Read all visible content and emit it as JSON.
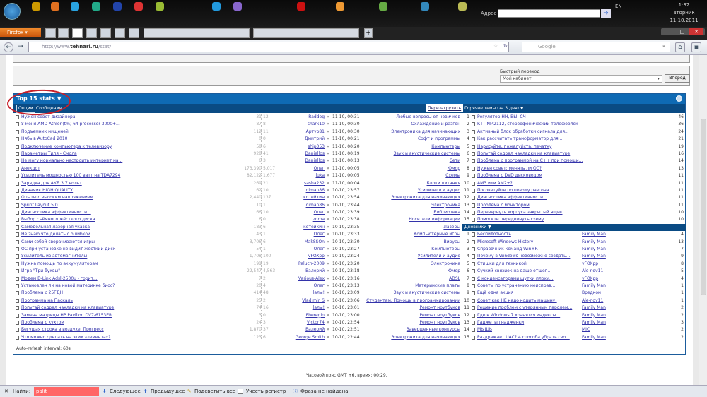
{
  "taskbar": {
    "address_label": "Адрес",
    "lang": "EN",
    "time": "1:32",
    "weekday": "вторник",
    "date": "11.10.2011"
  },
  "browser": {
    "menu_label": "Firefox",
    "url_host": "http://www.",
    "url_domain": "tehnari.ru",
    "url_path": "/stat/",
    "search_placeholder": "Google",
    "new_tab": "+"
  },
  "quick_jump": {
    "label": "Быстрый переход",
    "value": "Мой кабинет",
    "button": "Вперед"
  },
  "stats": {
    "title": "Top 15 stats ▼",
    "options": "Опции",
    "messages": "Сообщения",
    "reload": "Перезагрузить",
    "hot_header": "Горячие темы (за 3 дня) ▼",
    "diaries_header": "Дневники ▼",
    "auto_refresh": "Auto-refresh interval: 60s"
  },
  "threads": [
    [
      "Нужен совет дизайнера",
      "31",
      "12",
      "Raddog",
      "11-10, 00:31",
      "Любые вопросы от новичков"
    ],
    [
      "У меня AMD Athlon(tm) 64 processor 3000+...",
      "87",
      "8",
      "shark10",
      "11-10, 00:30",
      "Охлаждение и разгон"
    ],
    [
      "Подъемник нищеней",
      "112",
      "11",
      "Артур81",
      "11-10, 00:30",
      "Электроника для начинающих"
    ],
    [
      "Нябь в AutoCad 2010",
      "0",
      "0",
      "Дмитрий",
      "11-10, 00:21",
      "Софт и программы"
    ],
    [
      "Подключение компьютера к телевизору",
      "58",
      "6",
      "ship053",
      "11-10, 00:20",
      "Компьютеры"
    ],
    [
      "Параметры Тиля - Смола",
      "928",
      "41",
      "Daniellos",
      "11-10, 00:19",
      "Звук и акустические системы"
    ],
    [
      "Не могу нормально настроить интернет на...",
      "6",
      "3",
      "Daniellos",
      "11-10, 00:13",
      "Сети"
    ],
    [
      "Анекдот",
      "173,390",
      "5,017",
      "Олег",
      "11-10, 00:05",
      "Юмор"
    ],
    [
      "Усилитель мощностью 100 ватт на TDA7294",
      "82,122",
      "1,677",
      "luka",
      "11-10, 00:05",
      "Схемы"
    ],
    [
      "Зарядка для АКБ 3,7 вольт",
      "269",
      "21",
      "sasha232",
      "11-10, 00:04",
      "Блоки питания"
    ],
    [
      "Динамик HIGH QUALITY",
      "62",
      "10",
      "diman86",
      "10-10, 23:57",
      "Усилители и аудио"
    ],
    [
      "Опыты с высоким напряжением",
      "2,440",
      "137",
      "котейкин",
      "10-10, 23:54",
      "Электроника для начинающих"
    ],
    [
      "Sprint Layout 5.0",
      "10",
      "1",
      "diman86",
      "10-10, 23:44",
      "Электроника"
    ],
    [
      "Диагностика эффективности...",
      "66",
      "10",
      "Олег",
      "10-10, 23:39",
      "Библиотека"
    ],
    [
      "Выбор съёмного жёсткого диска",
      "6",
      "0",
      "zoma",
      "10-10, 23:38",
      "Носители информации"
    ],
    [
      "Самодельная лазерная указка",
      "183",
      "6",
      "котейкин",
      "10-10, 23:35",
      "Лазеры"
    ],
    [
      "Не знаю что делать с ошибкой",
      "43",
      "1",
      "Олег",
      "10-10, 23:33",
      "Компьютерные игры"
    ],
    [
      "Сами собой сворачиваются игры",
      "3,706",
      "6",
      "MakSSOn",
      "10-10, 23:30",
      "Вирусы"
    ],
    [
      "ОС при установке не видит жесткий диск",
      "54",
      "1",
      "Олег",
      "10-10, 23:27",
      "Компьютеры"
    ],
    [
      "Усилитель из автомагнитолы",
      "1,708",
      "100",
      "vFOXpp",
      "10-10, 23:24",
      "Усилители и аудио"
    ],
    [
      "Нужна помощь по аккумуляторам",
      "191",
      "19",
      "Paluch-2009",
      "10-10, 23:20",
      "Электроника"
    ],
    [
      "Игра \"Три буквы\"",
      "22,547",
      "4,563",
      "Валерий",
      "10-10, 23:18",
      "Юмор"
    ],
    [
      "Модем D-Link Adsl-2500u - горит...",
      "7",
      "2",
      "Various-Alex",
      "10-10, 23:16",
      "ADSL"
    ],
    [
      "Установлен ли на новой материнке биос?",
      "20",
      "4",
      "Олег",
      "10-10, 23:13",
      "Материнские платы"
    ],
    [
      "Проблема с 25ГДН",
      "414",
      "48",
      "lалы!",
      "10-10, 23:09",
      "Звук и акустические системы"
    ],
    [
      "Программа на Паскаль",
      "25",
      "2",
      "Vladimir_S",
      "10-10, 23:06",
      "Студентам. Помощь в программировании"
    ],
    [
      "Попугай содрал накладки на клавиатуре",
      "74",
      "16",
      "lалы!",
      "10-10, 23:01",
      "Ремонт ноутбуков"
    ],
    [
      "Замена матрицы HP Pavilion DV7-6153ER",
      "3",
      "0",
      "Pberegin",
      "10-10, 23:00",
      "Ремонт ноутбуков"
    ],
    [
      "Проблема с кухтом",
      "24",
      "3",
      "Victor74",
      "10-10, 22:54",
      "Ремонт ноутбуков"
    ],
    [
      "Бегущая строка в воздухе. Прогресс",
      "1,870",
      "37",
      "Валерий",
      "10-10, 22:51",
      "Завершенные конкурсы"
    ],
    [
      "Что можно сделать на этих элементах?",
      "123",
      "6",
      "George Smith",
      "10-10, 22:44",
      "Электроника для начинающих"
    ]
  ],
  "hot": [
    [
      "1",
      "Регулятор HH, ВЫ, СЧ",
      "46"
    ],
    [
      "2",
      "КТТ NM2112, стереофонический телефоблок",
      "36"
    ],
    [
      "3",
      "Активный блок обработки сигнала для...",
      "24"
    ],
    [
      "4",
      "Как рассчитать трансформатор для...",
      "21"
    ],
    [
      "5",
      "Нарисуйте, пожалуйста, печатку",
      "19"
    ],
    [
      "6",
      "Попугай содрал накладки на клавиатуре",
      "16"
    ],
    [
      "7",
      "Проблема с программой на C++ при помощи...",
      "14"
    ],
    [
      "8",
      "Нужен совет: менять ли ОС?",
      "13"
    ],
    [
      "9",
      "Проблема с DVD дисководом",
      "11"
    ],
    [
      "10",
      "AM3 или AM2+?",
      "11"
    ],
    [
      "11",
      "Посоветуйте по поводу разгона",
      "11"
    ],
    [
      "12",
      "Диагностика эффективности...",
      "11"
    ],
    [
      "13",
      "Проблема с монитором",
      "11"
    ],
    [
      "14",
      "Перевернуть корпуса закрытый ящик",
      "10"
    ],
    [
      "15",
      "Помогите передвинуть схему",
      "10"
    ]
  ],
  "diaries": [
    [
      "1",
      "Беспилотность",
      "Family Man",
      "4"
    ],
    [
      "2",
      "Microsoft Windows History",
      "Family Man",
      "13"
    ],
    [
      "3",
      "Справочник команд Win+R",
      "Family Man",
      "7"
    ],
    [
      "4",
      "Почему в Windows невозможно создать...",
      "Family Man",
      "9"
    ],
    [
      "5",
      "Стишки для техникой",
      "vFOXpp",
      "8"
    ],
    [
      "6",
      "Сучкий связиок на ваше отщеп...",
      "Ale-nov11",
      "5"
    ],
    [
      "7",
      "С конденсаторами шутки плохи...",
      "vFOXpp",
      "4"
    ],
    [
      "8",
      "Советы по устранению неисправ...",
      "Family Man",
      "1"
    ],
    [
      "9",
      "Ещё одна акция",
      "Вредкон",
      "1"
    ],
    [
      "10",
      "Совет как НЕ надо кодить машину!",
      "Ale-nov11",
      "1"
    ],
    [
      "11",
      "Решение проблем с утерянным паролем...",
      "Family Man",
      "2"
    ],
    [
      "12",
      "Где в Windows 7 хранятся индексы...",
      "Family Man",
      "2"
    ],
    [
      "13",
      "Гаджеты гнадженки",
      "Family Man",
      "3"
    ],
    [
      "14",
      "МЫШЬ",
      "MIC",
      "2"
    ],
    [
      "15",
      "Раздражает UAC? 4 способа убрать сво...",
      "Family Man",
      "2"
    ]
  ],
  "footer": {
    "timezone": "Часовой пояс GMT +6, время: 00:29."
  },
  "findbar": {
    "label": "Найти:",
    "value": "palit",
    "next": "Следующее",
    "prev": "Предыдущее",
    "highlight": "Подсветить все",
    "match_case": "Учесть регистр",
    "status": "Фраза не найдена"
  },
  "colors": {
    "header_blue": "#0f6ab4",
    "subheader_blue": "#0a4b84",
    "link": "#3333aa",
    "find_not_found": "#ff6666"
  }
}
